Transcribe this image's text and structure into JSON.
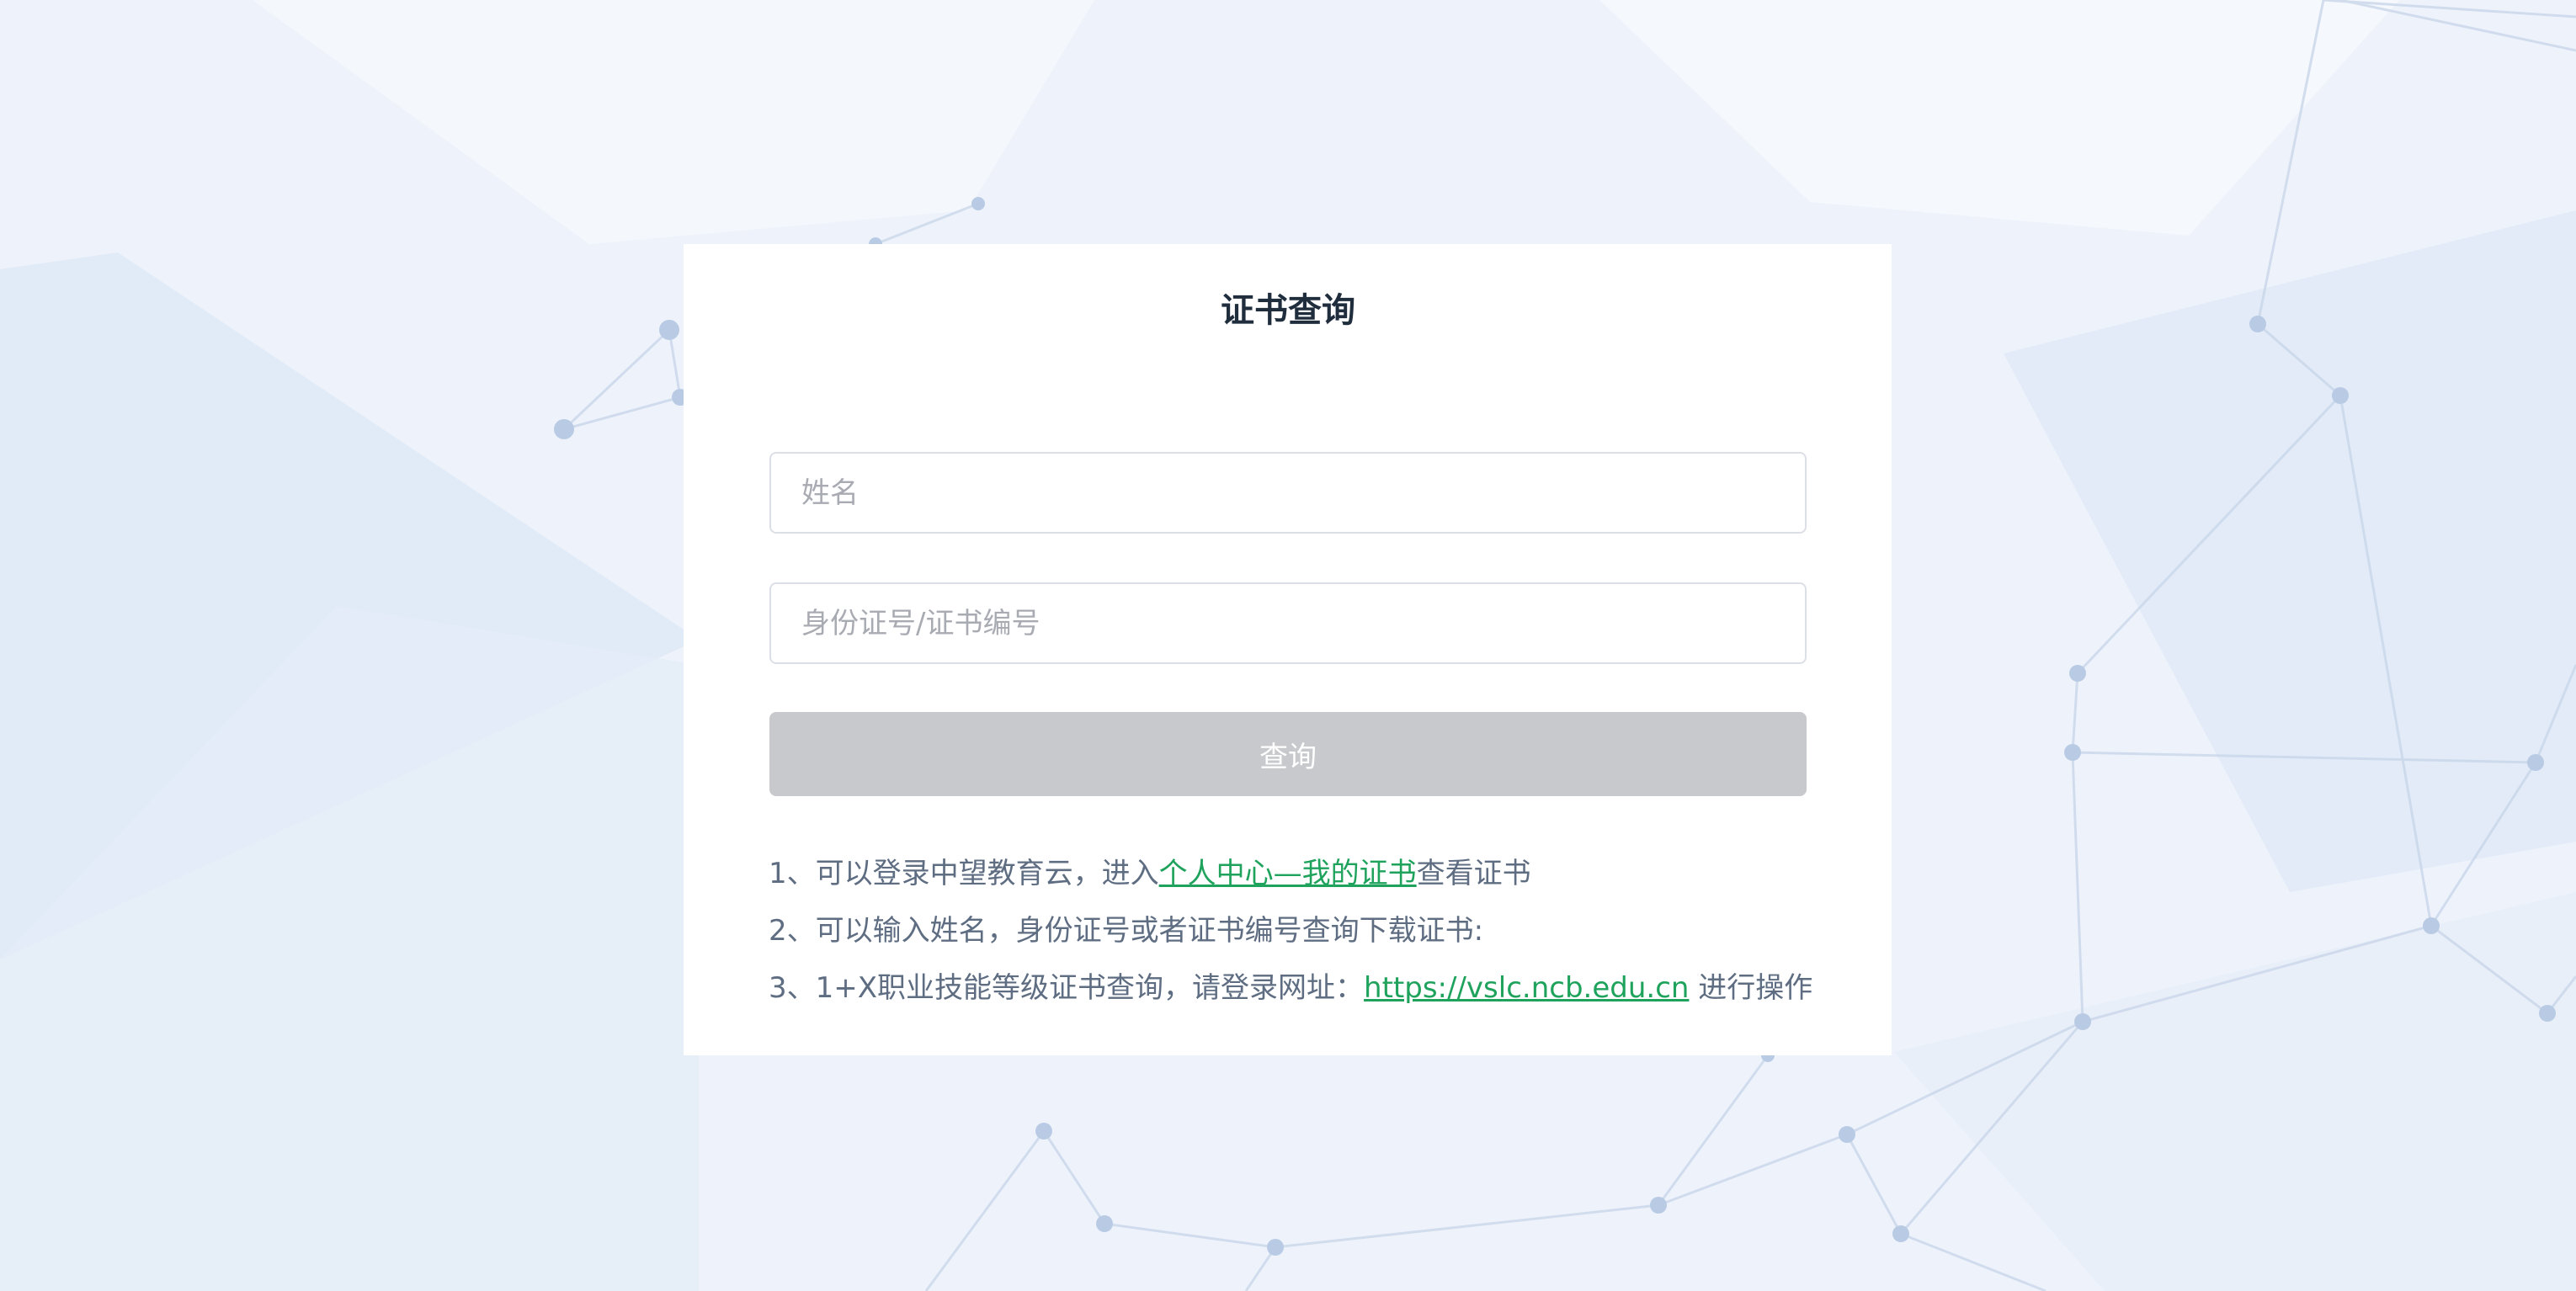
{
  "title": "证书查询",
  "form": {
    "name_placeholder": "姓名",
    "id_placeholder": "身份证号/证书编号",
    "submit_label": "查询"
  },
  "notes": [
    {
      "prefix": "1、可以登录中望教育云，进入",
      "link": "个人中心—我的证书",
      "suffix": "查看证书"
    },
    {
      "text": "2、可以输入姓名，身份证号或者证书编号查询下载证书:"
    },
    {
      "prefix": "3、1+X职业技能等级证书查询，请登录网址：",
      "link": "https://vslc.ncb.edu.cn",
      "suffix": " 进行操作"
    }
  ],
  "colors": {
    "link": "#1fa35c",
    "button_disabled": "#c8c9cc",
    "text": "#5e6d82",
    "title": "#1f2d3d"
  }
}
